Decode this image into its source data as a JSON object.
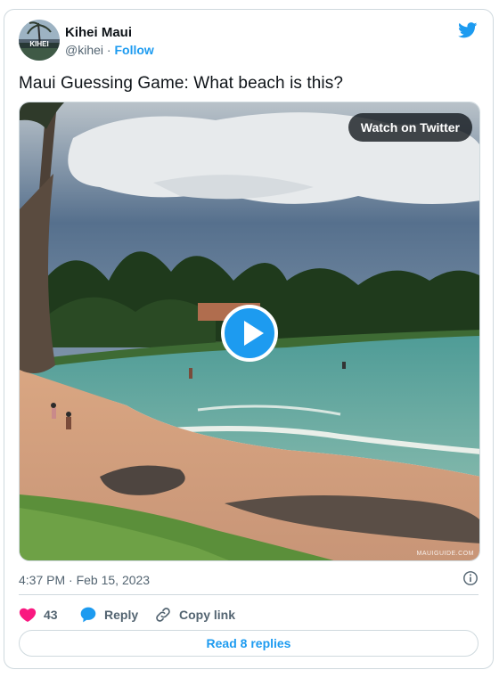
{
  "author": {
    "display_name": "Kihei Maui",
    "handle": "@kihei",
    "separator": " · ",
    "follow_label": "Follow",
    "avatar_text": "KIHEI"
  },
  "tweet": {
    "text": "Maui Guessing Game: What beach is this?"
  },
  "media": {
    "watch_label": "Watch on Twitter",
    "watermark": "MAUIGUIDE.COM",
    "play_icon": "play-icon"
  },
  "meta": {
    "timestamp": "4:37 PM · Feb 15, 2023",
    "info_icon": "info-icon"
  },
  "actions": {
    "like_count": "43",
    "reply_label": "Reply",
    "copy_label": "Copy link"
  },
  "footer": {
    "read_replies_label": "Read 8 replies"
  },
  "colors": {
    "accent": "#1d9bf0",
    "like": "#f91880",
    "muted": "#536471",
    "border": "#cfd9de"
  }
}
